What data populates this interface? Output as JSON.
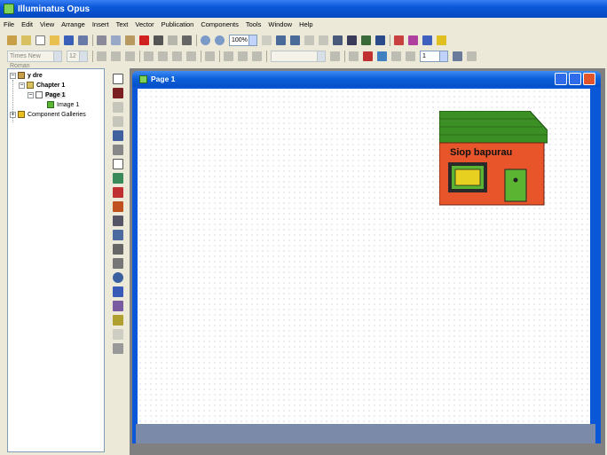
{
  "app": {
    "title": "Illuminatus Opus"
  },
  "menu": [
    "File",
    "Edit",
    "View",
    "Arrange",
    "Insert",
    "Text",
    "Vector",
    "Publication",
    "Components",
    "Tools",
    "Window",
    "Help"
  ],
  "toolbar": {
    "zoom_value": "100%"
  },
  "format_bar": {
    "font_value": "Times New Roman",
    "size_value": "12",
    "line_value": "1"
  },
  "tree": {
    "root": "y dre",
    "chapter": "Chapter 1",
    "page": "Page 1",
    "image": "Image 1",
    "galleries": "Component Galleries"
  },
  "document": {
    "title": "Page 1"
  },
  "shop_image": {
    "sign_text": "Siop bapurau"
  },
  "colors": {
    "accent": "#0a58d8",
    "roof": "#3c8f24",
    "wall": "#e8552b",
    "door": "#5bb533"
  }
}
